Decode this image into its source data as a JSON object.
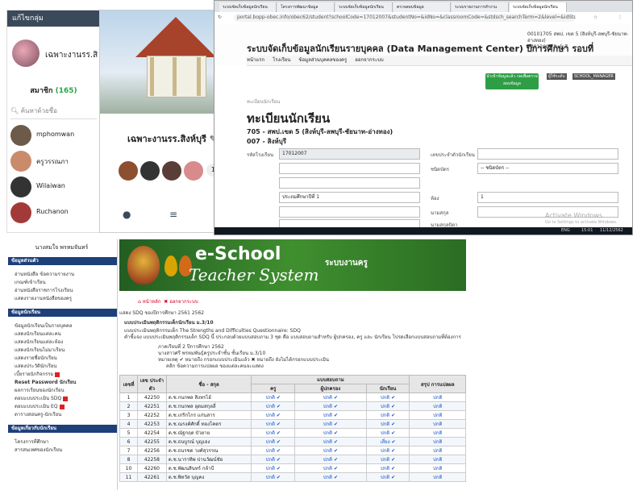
{
  "line_group": {
    "header_title": "แก้ไขกลุ่ม",
    "group_name": "เฉพาะงานรร.สิ",
    "members_label": "สมาชิก",
    "members_count": "(165)",
    "search_placeholder": "ค้นหาด้วยชื่อ",
    "members": [
      {
        "name": "mphomwan",
        "color": "#6c5a4a"
      },
      {
        "name": "ครูวรรณภา",
        "color": "#c98b6b"
      },
      {
        "name": "Wilaiwan",
        "color": "#333333"
      },
      {
        "name": "Ruchanon",
        "color": "#a33a3a"
      }
    ]
  },
  "post_card": {
    "title": "เฉพาะงานรร.สิงห์บุรี",
    "member_count": "165",
    "face_colors": [
      "#8c4f2f",
      "#333333",
      "#5a3d36",
      "#d98a8a"
    ],
    "icons": [
      "chat-icon",
      "notes-icon",
      "album-icon"
    ]
  },
  "browser": {
    "tabs": [
      "ระบบจัดเก็บข้อมูลนักเรียน",
      "โครงการพัฒนาข้อมูล",
      "ระบบจัดเก็บข้อมูลนักเรียน",
      "ตรวจสอบข้อมูล",
      "ระบบรายงานการทำงาน",
      "ระบบจัดเก็บข้อมูลนักเรียน"
    ],
    "url": "portal.bopp-obec.info/obec62/student?schoolCode=17012007&studentNo=&idNo=&classroomCode=&stdsch_searchTerm=2&level=&idStdsch=18&classroom=",
    "dmc_title": "ระบบจัดเก็บข้อมูลนักเรียนรายบุคคล (Data Management Center) ปีการศึกษา รอบที่",
    "school_line1": "00101705 สพป. เขต 5 (สิงห์บุรี-ลพบุรี-ชัยนาท-อ่างทอง)",
    "school_line2": "17012007 สิงห์บุรี",
    "menu": [
      "หน้าแรก",
      "โรงเรียน",
      "ข้อมูลส่วนบุคคลของครู",
      "ออกจากระบบ"
    ],
    "green_button": "นำเข้าข้อมูลแล้ว กดเพื่อตรวจสอบข้อมูล",
    "badges": [
      "ผู้ใช้ระดับ",
      "SCHOOL_MANAGER"
    ],
    "breadcrumb": "ทะเบียนนักเรียน",
    "register_title": "ทะเบียนนักเรียน",
    "register_sub1": "705 - สพป.เขต 5 (สิงห์บุรี-ลพบุรี-ชัยนาท-อ่างทอง)",
    "register_sub2": "007 - สิงห์บุรี",
    "form": {
      "school_code_label": "รหัสโรงเรียน",
      "school_code_value": "17012007",
      "id_label": "เลขประจำตัวนักเรียน",
      "type_label": "ชนิดบัตร",
      "type_value": "-- ชนิดบัตร --",
      "level_value": "ประถมศึกษาปีที่ 1",
      "room_label": "ห้อง",
      "room_value": "1",
      "lastname_label": "นามสกุล",
      "father_label": "นามสกุลบิดา",
      "mother_label": "นามสกุลมารดา",
      "mother_name_label": "ชื่อมารดา"
    },
    "watermark_1": "Activate Windows",
    "watermark_2": "Go to Settings to activate Windows.",
    "taskbar_time": "15:01",
    "taskbar_date": "11/12/2562",
    "taskbar_lang": "ENG"
  },
  "eschool": {
    "user_name": "นางสมใจ พรหมจันทร์",
    "brand_e": "e-School",
    "brand_script": "Teacher System",
    "system_title": "ระบบงานครู",
    "nav_home": "หน้าหลัก",
    "nav_logout": "ออกจากระบบ",
    "sections": [
      {
        "title": "ข้อมูลส่วนตัว",
        "links": [
          "อ่านหนังสือ ข้อความรายงาน",
          "เกณฑ์เข้าเรียน",
          "อ่านหนังสือราชการโรงเรียน",
          "แสดงรายงานหนังสือของครู"
        ]
      },
      {
        "title": "ข้อมูลนักเรียน",
        "links": [
          "ข้อมูลนักเรียนเป็นรายบุคคล",
          "แสดงนักเรียนแต่ละคน",
          "แสดงนักเรียนแต่ละห้อง",
          "แสดงนักเรียนไม่มาเรียน",
          "แสดงรายชื่อนักเรียน",
          "แสดงประวัตินักเรียน",
          "เบี้ยรายนักกิจกรรม",
          "Reset Password นักเรียน",
          "ผลการเรียนของนักเรียน",
          "ตอบแบบประเมิน SDQ",
          "ตอบแบบประเมิน EQ",
          "ตารางสอนครู-นักเรียน"
        ]
      },
      {
        "title": "ข้อมูลเกี่ยวกับนักเรียน",
        "links": [
          "โครงการที่ศึกษา",
          "สารสนเทศของนักเรียน"
        ]
      }
    ],
    "page_heading": "แสดง SDQ ของปีการศึกษา 2561 2562",
    "section_heading": "แบบประเมินพฤติกรรมเด็กนักเรียน ม.3/10",
    "intro_1": "แบบประเมินพฤติกรรมเด็ก The Strengths and Difficulties Questionnaire: SDQ",
    "intro_2": "คำชี้แจง แบบประเมินพฤติกรรมเด็ก SDQ นี้ ประกอบด้วยแบบสอบถาม 3 ชุด คือ แบบสอบถามสำหรับ ผู้ปกครอง, ครู และ นักเรียน โปรดเลือกแบบสอบถามที่ต้องการ",
    "term_line": "ภาคเรียนที่ 2 ปีการศึกษา 2562",
    "teacher_line": "นางสาวศรี พรหมพันธุ์ครูประจำชั้น ชั้นเรียน ม.3/10",
    "legend_line": "หมายเหตุ ✔ หมายถึง กรอกแบบประเมินแล้ว ✖ หมายถึง ยังไม่ได้กรอกแบบประเมิน",
    "legend_click": "คลิก ข้อความการแปลผล ของแต่ละคนจะแสดง",
    "table": {
      "headers": [
        "เลขที่",
        "เลข ประจำตัว",
        "ชื่อ - สกุล",
        "แบบสอบถาม",
        "สรุป การแปลผล"
      ],
      "subheaders": [
        "ครู",
        "ผู้ปกครอง",
        "นักเรียน"
      ],
      "rows": [
        {
          "no": "1",
          "id": "42250",
          "name": "ด.ช.กนกพล สิงหรไฮ้",
          "teacher": "ปกติ ✔",
          "parent": "ปกติ ✔",
          "student": "ปกติ ✔",
          "result": "ปกติ"
        },
        {
          "no": "2",
          "id": "42251",
          "name": "ด.ช.กนกพล อุดมสกุลลี่",
          "teacher": "ปกติ ✔",
          "parent": "ปกติ ✔",
          "student": "ปกติ ✔",
          "result": "ปกติ"
        },
        {
          "no": "3",
          "id": "42252",
          "name": "ด.ช.เกริกไกร แก่นสาร",
          "teacher": "ปกติ ✔",
          "parent": "ปกติ ✔",
          "student": "ปกติ ✔",
          "result": "ปกติ"
        },
        {
          "no": "4",
          "id": "42253",
          "name": "ด.ช.ณรงค์ศักดิ์ ทองโคตร",
          "teacher": "ปกติ ✔",
          "parent": "ปกติ ✔",
          "student": "ปกติ ✔",
          "result": "ปกติ"
        },
        {
          "no": "5",
          "id": "42254",
          "name": "ด.ช.ณัฐกฤต บัวยาย",
          "teacher": "ปกติ ✔",
          "parent": "ปกติ ✔",
          "student": "ปกติ ✔",
          "result": "ปกติ"
        },
        {
          "no": "6",
          "id": "42255",
          "name": "ด.ช.ธนบูรณ์ บุญเอง",
          "teacher": "ปกติ ✔",
          "parent": "ปกติ ✔",
          "student": "เสี่ยง ✔",
          "result": "ปกติ"
        },
        {
          "no": "7",
          "id": "42256",
          "name": "ด.ช.ธนรชต วงศ์สุวรรณ",
          "teacher": "ปกติ ✔",
          "parent": "ปกติ ✔",
          "student": "ปกติ ✔",
          "result": "ปกติ"
        },
        {
          "no": "8",
          "id": "42258",
          "name": "ด.ช.นาราทิพ ปานวัฒน์ชัย",
          "teacher": "ปกติ ✔",
          "parent": "ปกติ ✔",
          "student": "ปกติ ✔",
          "result": "ปกติ"
        },
        {
          "no": "10",
          "id": "42260",
          "name": "ด.ช.พัฒนสินทร์ กล้าบี",
          "teacher": "ปกติ ✔",
          "parent": "ปกติ ✔",
          "student": "ปกติ ✔",
          "result": "ปกติ"
        },
        {
          "no": "11",
          "id": "42261",
          "name": "ด.ช.พิทวัส บุญคง",
          "teacher": "ปกติ ✔",
          "parent": "ปกติ ✔",
          "student": "ปกติ ✔",
          "result": "ปกติ"
        }
      ]
    }
  }
}
